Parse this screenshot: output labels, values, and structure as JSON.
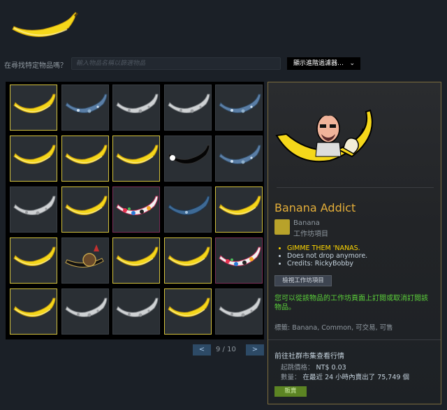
{
  "search": {
    "label": "在尋找特定物品嗎？",
    "placeholder": "輸入物品名稱以篩選物品",
    "filter_button": "顯示進階過濾器…"
  },
  "inventory": {
    "slots": [
      "banana",
      "moon-blue",
      "moon",
      "moon",
      "moon-blue",
      "banana",
      "banana",
      "banana",
      "dark",
      "moon-blue",
      "moon",
      "banana",
      "sticker",
      "blue",
      "banana",
      "banana",
      "pirate",
      "banana",
      "banana",
      "sticker",
      "banana",
      "moon",
      "moon",
      "banana",
      "moon"
    ],
    "selected": [
      0,
      5,
      6,
      7,
      11,
      14,
      15,
      17,
      18,
      20,
      23
    ],
    "pink": [
      12,
      19
    ]
  },
  "pager": {
    "prev": "<",
    "next": ">",
    "text": "9 / 10"
  },
  "detail": {
    "name": "Banana Addict",
    "game": "Banana",
    "type": "工作坊項目",
    "description": [
      "GIMME THEM 'NANAS.",
      "Does not drop anymore.",
      "Credits: RickyBobby"
    ],
    "workshop_button": "檢視工作坊項目",
    "subscribe_note": "您可以從該物品的工作坊頁面上訂閱或取消訂閱該物品。",
    "tags": "標籤: Banana, Common, 可交易, 可售",
    "market_title": "前往社群市集查看行情",
    "price_label": "起跳價格：",
    "price_value": "NT$ 0.03",
    "volume_label": "數量：",
    "volume_value": "在最近 24 小時內賣出了 75,749 個",
    "sell_button": "販賣"
  },
  "colors": {
    "name": "#e4ae39",
    "highlight": "#ffd700",
    "note": "#5bd13a",
    "selected_border": "#d2c13d"
  }
}
